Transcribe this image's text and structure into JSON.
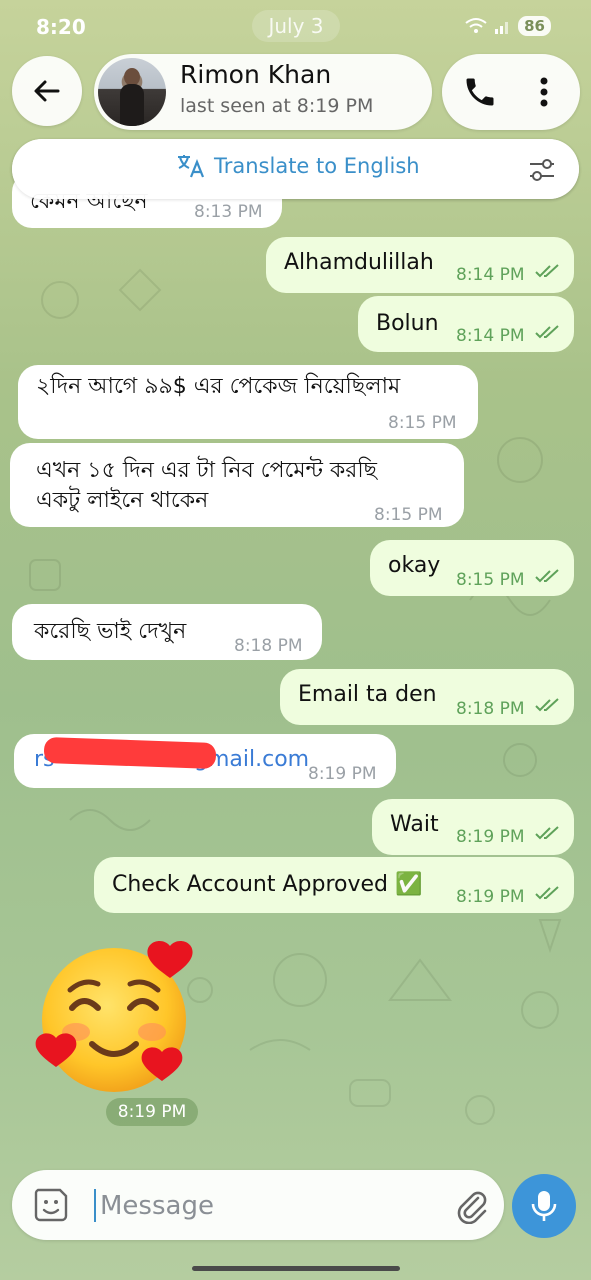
{
  "status_bar": {
    "time": "8:20",
    "date_pill": "July 3",
    "battery": "86"
  },
  "header": {
    "contact_name": "Rimon Khan",
    "contact_status": "last seen at 8:19 PM"
  },
  "translate": {
    "label": "Translate to English"
  },
  "messages": [
    {
      "dir": "in",
      "text": "কেমন আছেন",
      "time": "8:13 PM"
    },
    {
      "dir": "out",
      "text": "Alhamdulillah",
      "time": "8:14 PM"
    },
    {
      "dir": "out",
      "text": "Bolun",
      "time": "8:14 PM"
    },
    {
      "dir": "in",
      "text": "২দিন আগে ৯৯$ এর পেকেজ নিয়েছিলাম",
      "time": "8:15 PM"
    },
    {
      "dir": "in",
      "text": "এখন ১৫ দিন এর টা নিব পেমেন্ট করছি",
      "text2": "একটু লাইনে থাকেন",
      "time": "8:15 PM"
    },
    {
      "dir": "out",
      "text": "okay",
      "time": "8:15 PM"
    },
    {
      "dir": "in",
      "text": "করেছি ভাই দেখুন",
      "time": "8:18 PM"
    },
    {
      "dir": "out",
      "text": "Email ta den",
      "time": "8:18 PM"
    },
    {
      "dir": "in",
      "text": "rs",
      "text2": "gmail.com",
      "time": "8:19 PM"
    },
    {
      "dir": "out",
      "text": "Wait",
      "time": "8:19 PM"
    },
    {
      "dir": "out",
      "text": "Check Account Approved ✅",
      "time": "8:19 PM"
    }
  ],
  "sticker": {
    "emoji": "smiling-face-with-hearts",
    "time": "8:19 PM"
  },
  "composer": {
    "placeholder": "Message"
  },
  "colors": {
    "accent": "#3d95d9",
    "outgoing_bubble": "#effdde",
    "incoming_bubble": "#ffffff",
    "redaction": "#ff3b3b"
  }
}
